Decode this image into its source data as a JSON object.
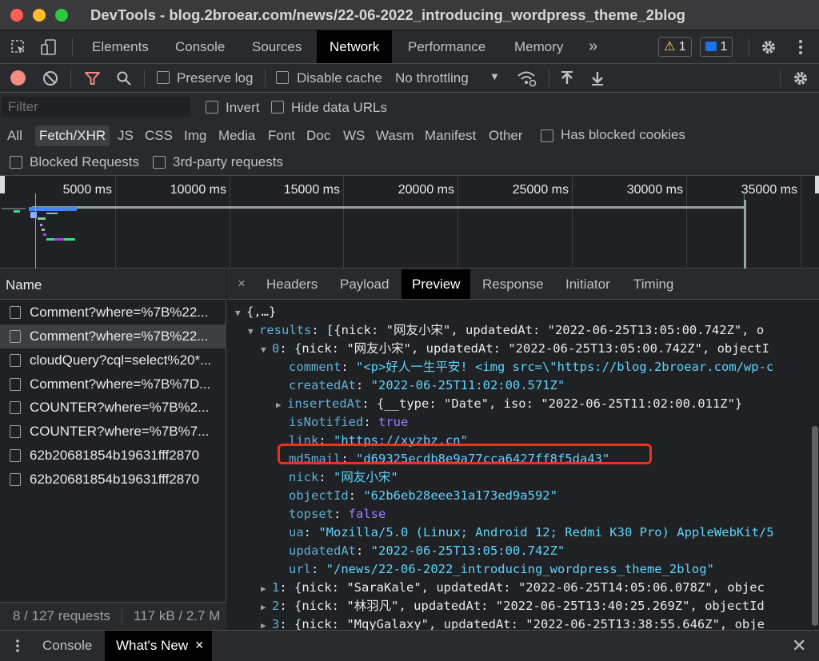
{
  "window": {
    "title": "DevTools - blog.2broear.com/news/22-06-2022_introducing_wordpress_theme_2blog"
  },
  "main_tabs": [
    "Elements",
    "Console",
    "Sources",
    "Network",
    "Performance",
    "Memory"
  ],
  "more_tabs": "»",
  "badges": {
    "warnings": "1",
    "messages": "1"
  },
  "toolbar": {
    "preserve_log": "Preserve log",
    "disable_cache": "Disable cache",
    "throttling": "No throttling"
  },
  "filter": {
    "placeholder": "Filter",
    "invert": "Invert",
    "hide_data_urls": "Hide data URLs",
    "types": [
      "All",
      "Fetch/XHR",
      "JS",
      "CSS",
      "Img",
      "Media",
      "Font",
      "Doc",
      "WS",
      "Wasm",
      "Manifest",
      "Other"
    ],
    "has_blocked_cookies": "Has blocked cookies",
    "blocked_requests": "Blocked Requests",
    "third_party": "3rd-party requests"
  },
  "overview": {
    "ticks": [
      "5000 ms",
      "10000 ms",
      "15000 ms",
      "20000 ms",
      "25000 ms",
      "30000 ms",
      "35000 ms"
    ]
  },
  "requests": {
    "header": "Name",
    "items": [
      "Comment?where=%7B%22...",
      "Comment?where=%7B%22...",
      "cloudQuery?cql=select%20*...",
      "Comment?where=%7B%7D...",
      "COUNTER?where=%7B%2...",
      "COUNTER?where=%7B%7...",
      "62b20681854b19631fff2870",
      "62b20681854b19631fff2870"
    ],
    "count": "8 / 127 requests",
    "size": "117 kB / 2.7 M"
  },
  "detail_tabs": [
    "Headers",
    "Payload",
    "Preview",
    "Response",
    "Initiator",
    "Timing"
  ],
  "preview": {
    "root": "{,…}",
    "results_key": "results",
    "results_summary": "[{nick: \"网友小宋\", updatedAt: \"2022-06-25T13:05:00.742Z\", o",
    "item0_key": "0",
    "item0_summary": "{nick: \"网友小宋\", updatedAt: \"2022-06-25T13:05:00.742Z\", objectI",
    "fields": [
      {
        "key": "comment",
        "value": "\"<p>好人一生平安! <img src=\\\"https://blog.2broear.com/wp-c",
        "type": "s"
      },
      {
        "key": "createdAt",
        "value": "\"2022-06-25T11:02:00.571Z\"",
        "type": "s"
      },
      {
        "key": "insertedAt",
        "value": "{__type: \"Date\", iso: \"2022-06-25T11:02:00.011Z\"}",
        "type": "o"
      },
      {
        "key": "isNotified",
        "value": "true",
        "type": "b"
      },
      {
        "key": "link",
        "value": "\"https://xyzbz.cn\"",
        "type": "s"
      },
      {
        "key": "md5mail",
        "value": "\"d69325ecdb8e9a77cca6427ff8f5da43\"",
        "type": "s"
      },
      {
        "key": "nick",
        "value": "\"网友小宋\"",
        "type": "s"
      },
      {
        "key": "objectId",
        "value": "\"62b6eb28eee31a173ed9a592\"",
        "type": "s"
      },
      {
        "key": "topset",
        "value": "false",
        "type": "b"
      },
      {
        "key": "ua",
        "value": "\"Mozilla/5.0 (Linux; Android 12; Redmi K30 Pro) AppleWebKit/5",
        "type": "s"
      },
      {
        "key": "updatedAt",
        "value": "\"2022-06-25T13:05:00.742Z\"",
        "type": "s"
      },
      {
        "key": "url",
        "value": "\"/news/22-06-2022_introducing_wordpress_theme_2blog\"",
        "type": "s"
      }
    ],
    "collapsed": [
      {
        "key": "1",
        "summary": "{nick: \"SaraKale\", updatedAt: \"2022-06-25T14:05:06.078Z\", objec"
      },
      {
        "key": "2",
        "summary": "{nick: \"林羽凡\", updatedAt: \"2022-06-25T13:40:25.269Z\", objectId"
      },
      {
        "key": "3",
        "summary": "{nick: \"MqyGalaxy\", updatedAt: \"2022-06-25T13:38:55.646Z\", obje"
      }
    ]
  },
  "drawer": {
    "console": "Console",
    "whats_new": "What's New"
  }
}
